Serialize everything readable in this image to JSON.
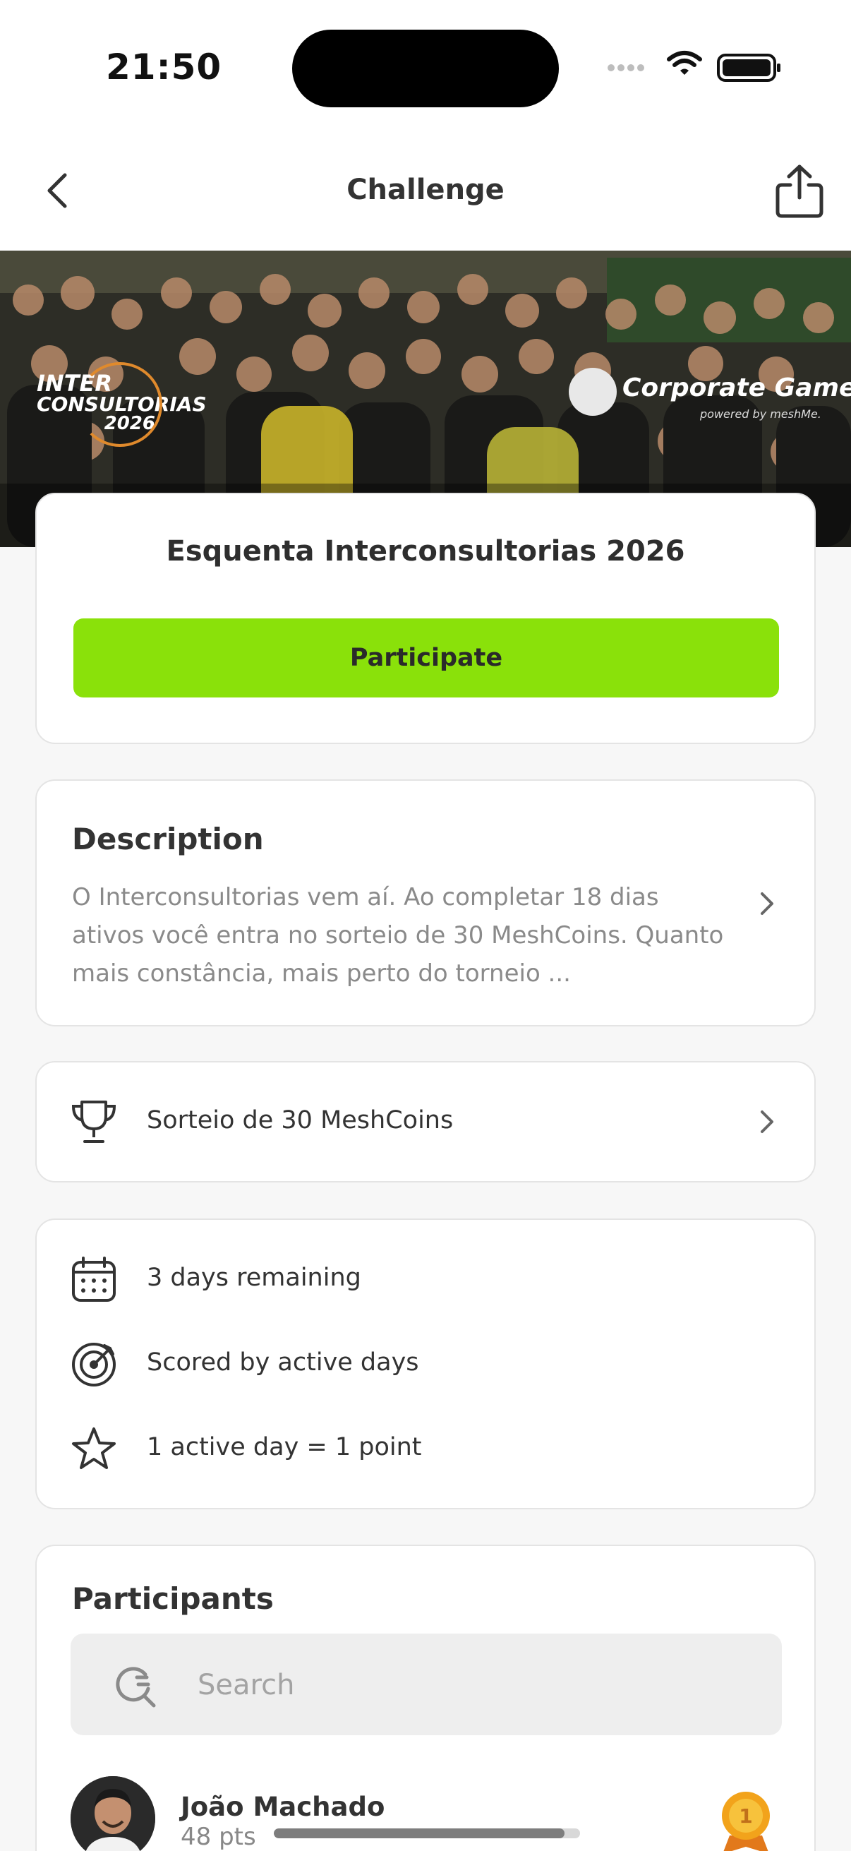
{
  "status_bar": {
    "time": "21:50"
  },
  "nav": {
    "title": "Challenge"
  },
  "hero": {
    "logo_left_line1": "INTER",
    "logo_left_line2": "CONSULTORIAS",
    "logo_left_line3": "2026",
    "logo_right_name": "Corporate Games",
    "logo_right_sub": "powered by meshMe."
  },
  "challenge": {
    "title": "Esquenta Interconsultorias 2026",
    "participate_label": "Participate"
  },
  "description": {
    "heading": "Description",
    "text": "O Interconsultorias vem aí. Ao completar 18 dias ativos você entra no sorteio de 30 MeshCoins. Quanto mais constância, mais perto do torneio ..."
  },
  "prize": {
    "label": "Sorteio de 30 MeshCoins",
    "icon": "trophy-icon"
  },
  "info": {
    "remaining": "3 days remaining",
    "scoring": "Scored by active days",
    "rule": "1 active day = 1 point"
  },
  "participants": {
    "heading": "Participants",
    "search_placeholder": "Search",
    "list": [
      {
        "name": "João Machado",
        "points": "48 pts",
        "progress": 0.95,
        "rank": "1"
      }
    ]
  },
  "colors": {
    "accent": "#8ae10a",
    "background": "#f7f7f7",
    "card": "#ffffff",
    "medal": "#f2a31b"
  }
}
